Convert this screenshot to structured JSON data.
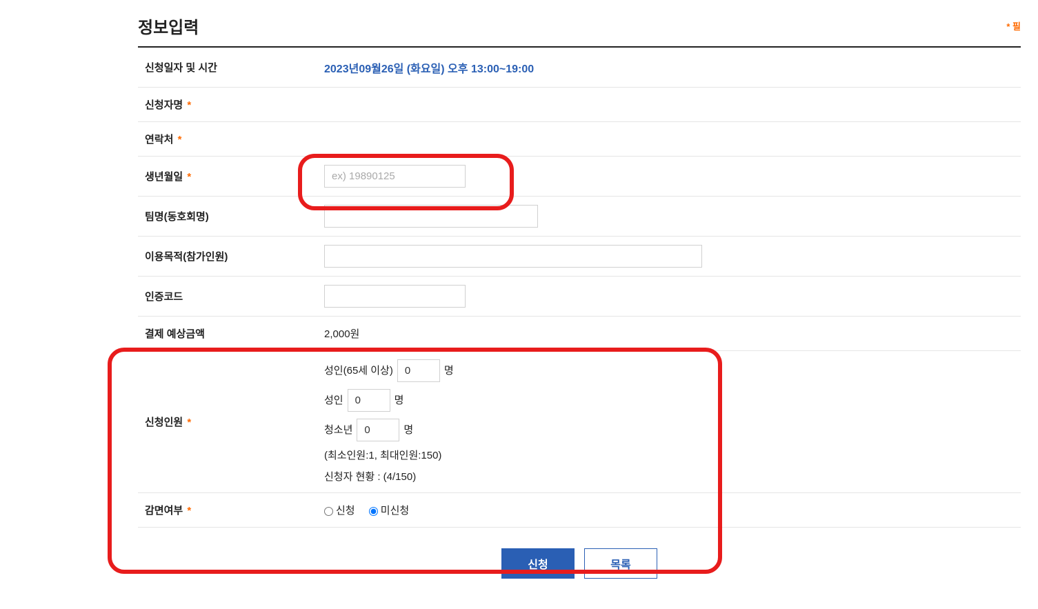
{
  "title": "정보입력",
  "required_note": "* 필",
  "rows": {
    "date_label": "신청일자 및 시간",
    "date_value": "2023년09월26일 (화요일) 오후 13:00~19:00",
    "applicant_label": "신청자명",
    "contact_label": "연락처",
    "dob_label": "생년월일",
    "dob_placeholder": "ex) 19890125",
    "team_label": "팀명(동호회명)",
    "purpose_label": "이용목적(참가인원)",
    "code_label": "인증코드",
    "amount_label": "결제 예상금액",
    "amount_value": "2,000원",
    "personnel_label": "신청인원",
    "exempt_label": "감면여부"
  },
  "personnel": {
    "senior_label_pre": "성인(65세 이상)",
    "senior_value": "0",
    "adult_label_pre": "성인",
    "adult_value": "0",
    "youth_label_pre": "청소년",
    "youth_value": "0",
    "unit": "명",
    "limits": "(최소인원:1, 최대인원:150)",
    "status": "신청자 현황 : (4/150)"
  },
  "exempt": {
    "apply": "신청",
    "not_apply": "미신청"
  },
  "buttons": {
    "submit": "신청",
    "list": "목록"
  }
}
